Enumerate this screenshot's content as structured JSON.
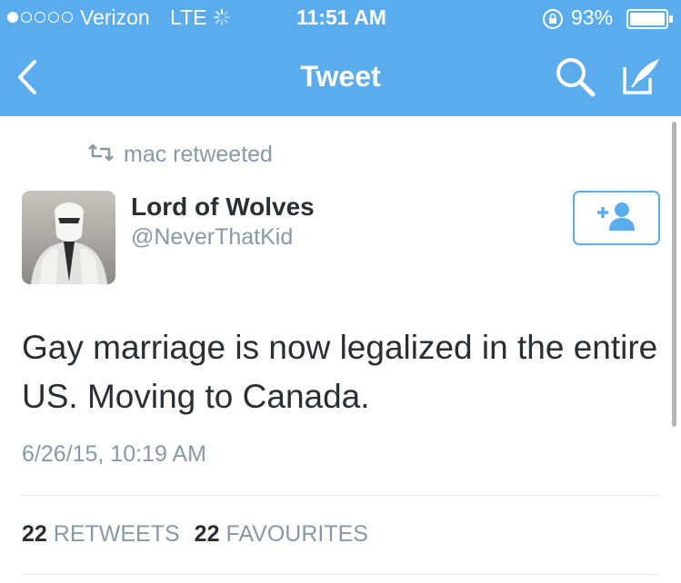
{
  "status_bar": {
    "carrier": "Verizon",
    "network": "LTE",
    "time": "11:51 AM",
    "battery": "93%",
    "signal_bars": 1,
    "signal_total": 5,
    "battery_level": 0.93
  },
  "nav": {
    "title": "Tweet",
    "icons": [
      "chevron-left-icon",
      "search-icon",
      "compose-icon"
    ]
  },
  "retweet_context": {
    "icon": "retweet-icon",
    "text": "mac retweeted"
  },
  "author": {
    "name": "Lord of Wolves",
    "handle": "@NeverThatKid",
    "avatar": "avatar-image"
  },
  "follow_button": {
    "icon": "add-user-icon"
  },
  "tweet": {
    "text": "Gay marriage is now legalized in the entire US. Moving to Canada.",
    "timestamp": "6/26/15, 10:19 AM"
  },
  "stats": {
    "retweets_count": "22",
    "retweets_label": "RETWEETS",
    "favourites_count": "22",
    "favourites_label": "FAVOURITES"
  },
  "colors": {
    "bar": "#5aacec",
    "text_primary": "#292f33",
    "text_secondary": "#8899a6",
    "divider": "#e1e8ed"
  }
}
